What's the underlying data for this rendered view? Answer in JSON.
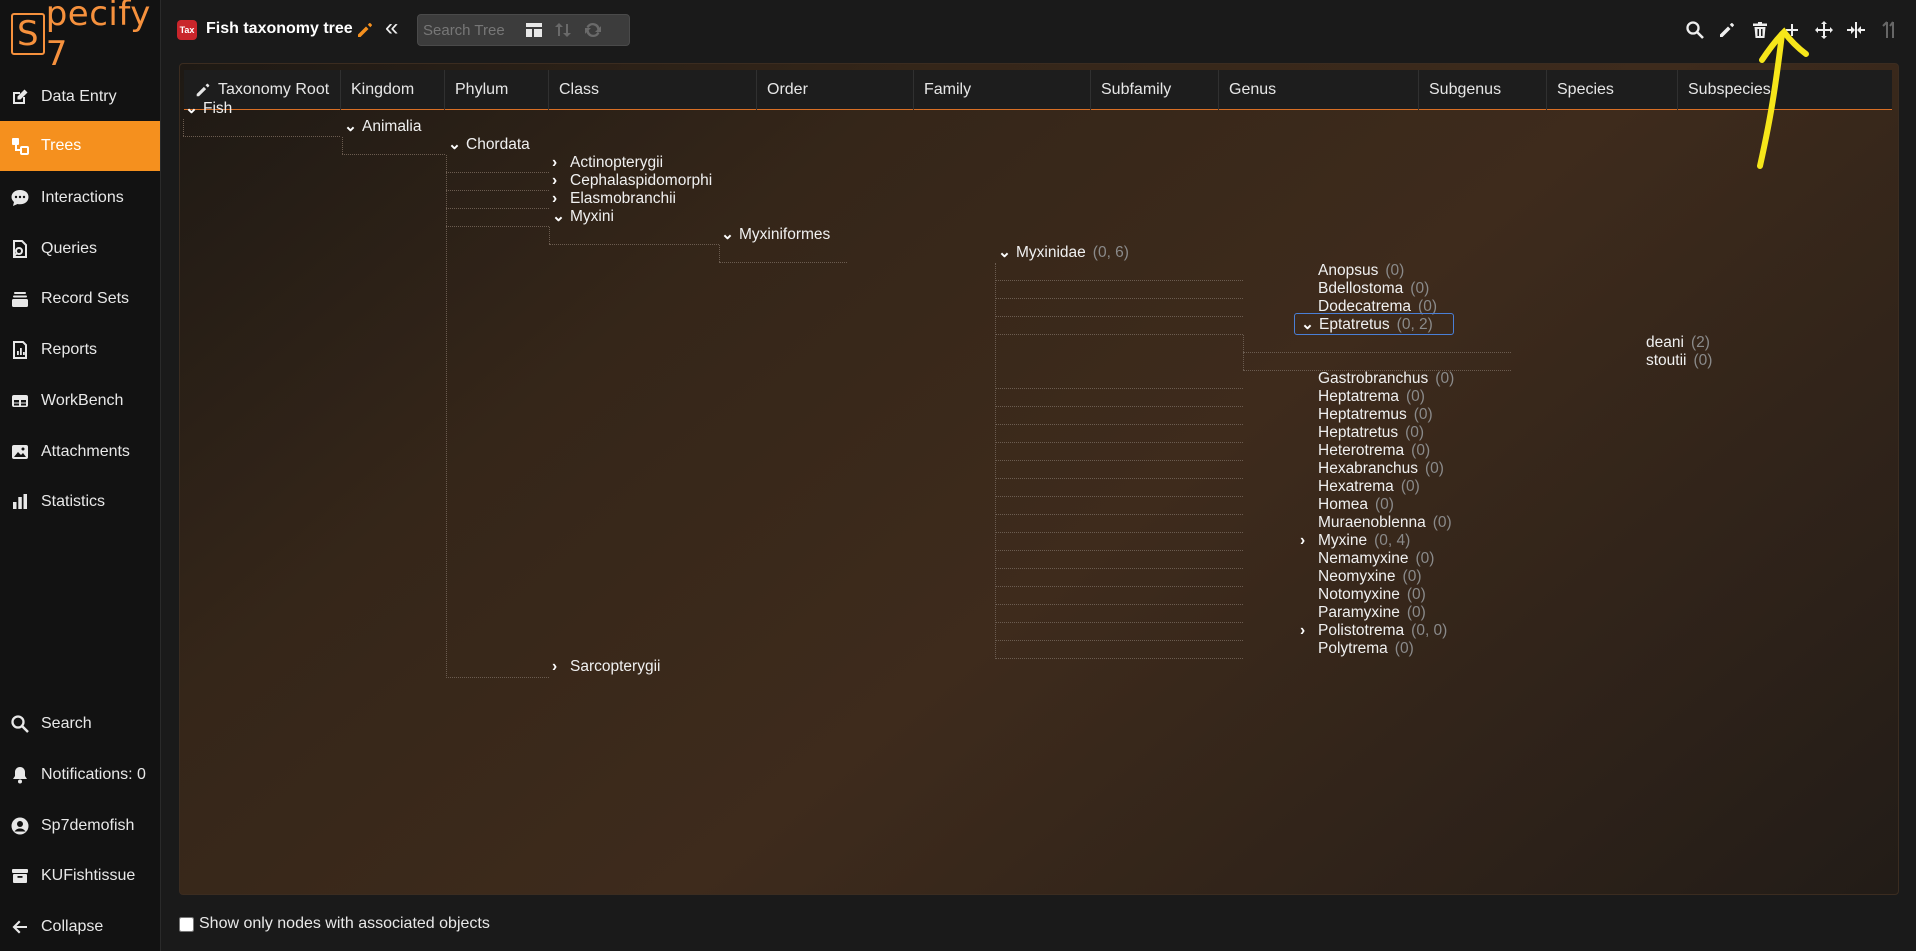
{
  "app": {
    "logo_text": "pecify 7",
    "logo_initial": "S"
  },
  "sidebar": {
    "items": [
      {
        "label": "Data Entry",
        "icon": "pencil-square-icon"
      },
      {
        "label": "Trees",
        "icon": "tree-icon",
        "active": true
      },
      {
        "label": "Interactions",
        "icon": "chat-icon"
      },
      {
        "label": "Queries",
        "icon": "query-icon"
      },
      {
        "label": "Record Sets",
        "icon": "stack-icon"
      },
      {
        "label": "Reports",
        "icon": "report-icon"
      },
      {
        "label": "WorkBench",
        "icon": "table-icon"
      },
      {
        "label": "Attachments",
        "icon": "image-icon"
      },
      {
        "label": "Statistics",
        "icon": "bar-chart-icon"
      }
    ],
    "bottom_items": [
      {
        "label": "Search",
        "icon": "search-icon"
      },
      {
        "label": "Notifications: 0",
        "icon": "bell-icon"
      },
      {
        "label": "Sp7demofish",
        "icon": "user-icon"
      },
      {
        "label": "KUFishtissue",
        "icon": "archive-icon"
      },
      {
        "label": "Collapse",
        "icon": "arrow-left-icon"
      }
    ]
  },
  "topbar": {
    "badge": "Tax",
    "title": "Fish taxonomy tree",
    "search_placeholder": "Search Tree",
    "left_icons": [
      "layout-icon",
      "sort-icon",
      "sync-icon"
    ],
    "right_icons": [
      "search-icon",
      "edit-icon",
      "trash-icon",
      "plus-icon",
      "move-icon",
      "merge-icon",
      "synonym-icon"
    ]
  },
  "ranks": [
    "Taxonomy Root",
    "Kingdom",
    "Phylum",
    "Class",
    "Order",
    "Family",
    "Subfamily",
    "Genus",
    "Subgenus",
    "Species",
    "Subspecies"
  ],
  "tree": {
    "nodes": [
      {
        "name": "Fish",
        "expanded": true
      },
      {
        "name": "Animalia",
        "expanded": true
      },
      {
        "name": "Chordata",
        "expanded": true
      },
      {
        "name": "Actinopterygii",
        "expanded": false
      },
      {
        "name": "Cephalaspidomorphi",
        "expanded": false
      },
      {
        "name": "Elasmobranchii",
        "expanded": false
      },
      {
        "name": "Myxini",
        "expanded": true
      },
      {
        "name": "Myxiniformes",
        "expanded": true
      },
      {
        "name": "Myxinidae",
        "count": "(0, 6)",
        "expanded": true
      },
      {
        "name": "Anopsus",
        "count": "(0)"
      },
      {
        "name": "Bdellostoma",
        "count": "(0)"
      },
      {
        "name": "Dodecatrema",
        "count": "(0)"
      },
      {
        "name": "Eptatretus",
        "count": "(0, 2)",
        "expanded": true,
        "focused": true
      },
      {
        "name": "deani",
        "count": "(2)"
      },
      {
        "name": "stoutii",
        "count": "(0)"
      },
      {
        "name": "Gastrobranchus",
        "count": "(0)"
      },
      {
        "name": "Heptatrema",
        "count": "(0)"
      },
      {
        "name": "Heptatremus",
        "count": "(0)"
      },
      {
        "name": "Heptatretus",
        "count": "(0)"
      },
      {
        "name": "Heterotrema",
        "count": "(0)"
      },
      {
        "name": "Hexabranchus",
        "count": "(0)"
      },
      {
        "name": "Hexatrema",
        "count": "(0)"
      },
      {
        "name": "Homea",
        "count": "(0)"
      },
      {
        "name": "Muraenoblenna",
        "count": "(0)"
      },
      {
        "name": "Myxine",
        "count": "(0, 4)",
        "expanded": false
      },
      {
        "name": "Nemamyxine",
        "count": "(0)"
      },
      {
        "name": "Neomyxine",
        "count": "(0)"
      },
      {
        "name": "Notomyxine",
        "count": "(0)"
      },
      {
        "name": "Paramyxine",
        "count": "(0)"
      },
      {
        "name": "Polistotrema",
        "count": "(0, 0)",
        "expanded": false
      },
      {
        "name": "Polytrema",
        "count": "(0)"
      },
      {
        "name": "Sarcopterygii",
        "expanded": false
      }
    ]
  },
  "footer": {
    "checkbox_label": "Show only nodes with associated objects",
    "checked": false
  },
  "colors": {
    "accent": "#f5901e",
    "badge": "#c9252b",
    "focus": "#4a7fd6",
    "annotation": "#f6e61a"
  }
}
